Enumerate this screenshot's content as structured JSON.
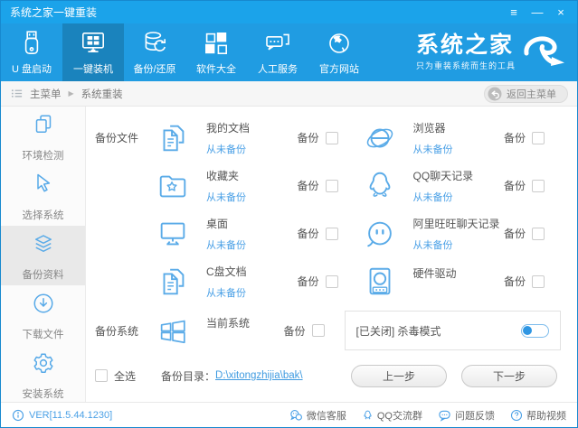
{
  "window": {
    "title": "系统之家一键重装",
    "controls": {
      "menu": "≡",
      "minimize": "—",
      "close": "×"
    }
  },
  "toolbar": {
    "tabs": [
      {
        "label": "U 盘启动"
      },
      {
        "label": "一键装机"
      },
      {
        "label": "备份/还原"
      },
      {
        "label": "软件大全"
      },
      {
        "label": "人工服务"
      },
      {
        "label": "官方网站"
      }
    ],
    "brand": {
      "name": "系统之家",
      "tagline": "只为重装系统而生的工具"
    }
  },
  "breadcrumb": {
    "root": "主菜单",
    "separator": "▶",
    "current": "系统重装",
    "back_button": "返回主菜单"
  },
  "sidebar": {
    "items": [
      {
        "label": "环境检测"
      },
      {
        "label": "选择系统"
      },
      {
        "label": "备份资料"
      },
      {
        "label": "下载文件"
      },
      {
        "label": "安装系统"
      }
    ]
  },
  "main": {
    "section_files": "备份文件",
    "section_system": "备份系统",
    "backup_label": "备份",
    "items": [
      {
        "name": "我的文档",
        "status": "从未备份"
      },
      {
        "name": "浏览器",
        "status": "从未备份"
      },
      {
        "name": "收藏夹",
        "status": "从未备份"
      },
      {
        "name": "QQ聊天记录",
        "status": "从未备份"
      },
      {
        "name": "桌面",
        "status": "从未备份"
      },
      {
        "name": "阿里旺旺聊天记录",
        "status": "从未备份"
      },
      {
        "name": "C盘文档",
        "status": "从未备份"
      },
      {
        "name": "硬件驱动",
        "status": ""
      }
    ],
    "system_item": {
      "name": "当前系统"
    },
    "antivirus_label": "[已关闭] 杀毒模式",
    "select_all": "全选",
    "backup_dir_label": "备份目录：",
    "backup_dir_path": "D:\\xitongzhijia\\bak\\",
    "prev_button": "上一步",
    "next_button": "下一步"
  },
  "footer": {
    "version": "VER[11.5.44.1230]",
    "links": [
      {
        "label": "微信客服"
      },
      {
        "label": "QQ交流群"
      },
      {
        "label": "问题反馈"
      },
      {
        "label": "帮助视频"
      }
    ]
  },
  "colors": {
    "titlebar": "#1ba3ea",
    "toolbar": "#209ce2",
    "accent_blue": "#56a9e8",
    "link": "#3f9be0"
  }
}
